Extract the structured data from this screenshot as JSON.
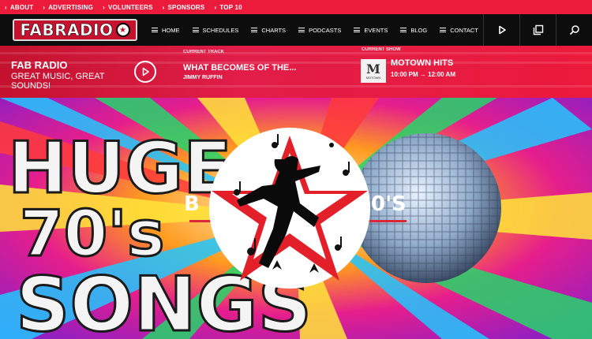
{
  "topbar": {
    "items": [
      {
        "label": "ABOUT"
      },
      {
        "label": "ADVERTISING"
      },
      {
        "label": "VOLUNTEERS"
      },
      {
        "label": "SPONSORS"
      },
      {
        "label": "TOP 10"
      }
    ]
  },
  "nav": {
    "logo_text": "FABRADIO",
    "items": [
      {
        "label": "HOME"
      },
      {
        "label": "SCHEDULES"
      },
      {
        "label": "CHARTS"
      },
      {
        "label": "PODCASTS"
      },
      {
        "label": "EVENTS"
      },
      {
        "label": "BLOG"
      },
      {
        "label": "CONTACT"
      }
    ],
    "buttons": [
      "play-icon",
      "popup-window-icon",
      "search-icon"
    ]
  },
  "player": {
    "station_title": "FAB RADIO",
    "station_tagline": "GREAT MUSIC, GREAT SOUNDS!",
    "current_track_label": "CURRENT TRACK",
    "track_title": "WHAT BECOMES OF THE...",
    "track_artist": "JIMMY RUFFIN",
    "current_show_label": "CURRENT SHOW",
    "show_thumb_letter": "M",
    "show_thumb_text": "MOTOWN",
    "show_title": "MOTOWN HITS",
    "show_start": "10:00 PM",
    "show_end": "12:00 AM"
  },
  "hero": {
    "big_text_1": "HUGE",
    "big_text_2": "70's",
    "big_text_3": "SONGS",
    "center_text_left": "B",
    "center_text_right": "0'S"
  },
  "colors": {
    "brand_red": "#ec1a3b",
    "nav_bg": "#0d0d0d"
  }
}
